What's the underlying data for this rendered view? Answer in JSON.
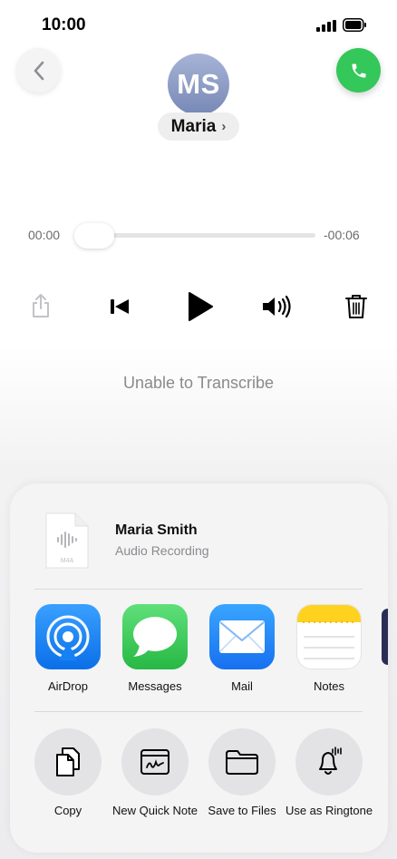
{
  "status_bar": {
    "time": "10:00"
  },
  "header": {
    "avatar_initials": "MS",
    "contact_name": "Maria",
    "chevron": "›"
  },
  "player": {
    "elapsed": "00:00",
    "remaining": "-00:06",
    "progress_fraction": 0.0,
    "transcription_status": "Unable to Transcribe"
  },
  "share_sheet": {
    "file_title": "Maria Smith",
    "file_subtitle": "Audio Recording",
    "file_type": "M4A",
    "apps": [
      {
        "label": "AirDrop",
        "icon": "airdrop-icon"
      },
      {
        "label": "Messages",
        "icon": "messages-icon"
      },
      {
        "label": "Mail",
        "icon": "mail-icon"
      },
      {
        "label": "Notes",
        "icon": "notes-icon"
      }
    ],
    "actions": [
      {
        "label": "Copy",
        "icon": "copy-icon"
      },
      {
        "label": "New Quick Note",
        "icon": "quick-note-icon"
      },
      {
        "label": "Save to Files",
        "icon": "folder-icon"
      },
      {
        "label": "Use as Ringtone",
        "icon": "bell-icon"
      }
    ]
  },
  "colors": {
    "call_green": "#34c759",
    "airdrop_blue": "#1e88ff",
    "messages_green": "#34c759",
    "mail_blue": "#1f8bff",
    "notes_yellow": "#ffd21f"
  }
}
